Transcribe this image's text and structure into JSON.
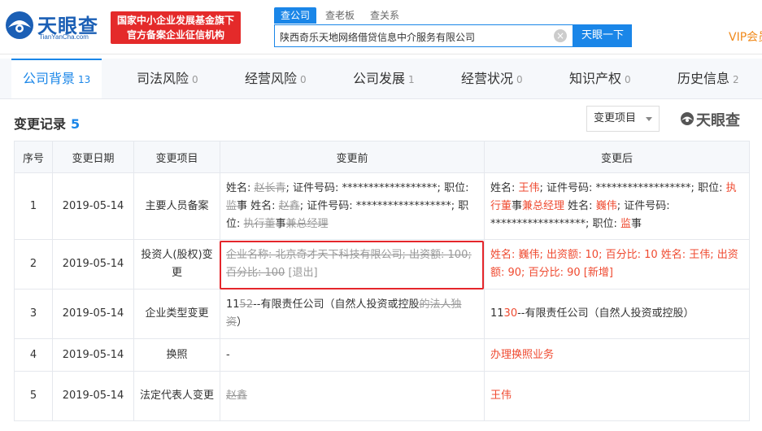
{
  "header": {
    "logo_name": "天眼查",
    "logo_domain": "TianYanCha.com",
    "badge_line1": "国家中小企业发展基金旗下",
    "badge_line2": "官方备案企业征信机构",
    "search_tabs": [
      "查公司",
      "查老板",
      "查关系"
    ],
    "search_value": "陕西奇乐天地网络借贷信息中介服务有限公司",
    "search_button": "天眼一下",
    "vip": "VIP会员"
  },
  "tabs": [
    {
      "label": "公司背景",
      "count": "13"
    },
    {
      "label": "司法风险",
      "count": "0"
    },
    {
      "label": "经营风险",
      "count": "0"
    },
    {
      "label": "公司发展",
      "count": "1"
    },
    {
      "label": "经营状况",
      "count": "0"
    },
    {
      "label": "知识产权",
      "count": "0"
    },
    {
      "label": "历史信息",
      "count": "2"
    }
  ],
  "section": {
    "title": "变更记录",
    "count": "5",
    "filter_label": "变更项目",
    "watermark": "天眼查"
  },
  "table": {
    "headers": [
      "序号",
      "变更日期",
      "变更项目",
      "变更前",
      "变更后"
    ],
    "rows": [
      {
        "no": "1",
        "date": "2019-05-14",
        "item": "主要人员备案",
        "before": [
          {
            "t": "姓名: "
          },
          {
            "t": "赵长青",
            "s": "strike"
          },
          {
            "t": "; 证件号码: ******************; 职位: "
          },
          {
            "t": "监",
            "s": "strike"
          },
          {
            "t": "事 姓名: "
          },
          {
            "t": "赵鑫",
            "s": "strike"
          },
          {
            "t": "; 证件号码: ******************; 职位: "
          },
          {
            "t": "执行董",
            "s": "strike"
          },
          {
            "t": "事"
          },
          {
            "t": "兼总经理",
            "s": "strike"
          }
        ],
        "after": [
          {
            "t": "姓名: "
          },
          {
            "t": "王伟",
            "s": "red"
          },
          {
            "t": "; 证件号码: ******************; 职位: "
          },
          {
            "t": "执行董",
            "s": "red"
          },
          {
            "t": "事"
          },
          {
            "t": "兼总经理",
            "s": "red"
          },
          {
            "t": " 姓名: "
          },
          {
            "t": "巍伟",
            "s": "red"
          },
          {
            "t": "; 证件号码: ******************; 职位: "
          },
          {
            "t": "监",
            "s": "red"
          },
          {
            "t": "事"
          }
        ]
      },
      {
        "no": "2",
        "date": "2019-05-14",
        "item": "投资人(股权)变更",
        "before": [
          {
            "t": "企业名称: 北京奇才天下科技有限公司; 出资额: 100; 百分比: 100",
            "s": "strike"
          },
          {
            "t": " [退出]",
            "s": "gray"
          }
        ],
        "after": [
          {
            "t": "姓名: 巍伟; 出资额: 10; 百分比: 10 姓名: 王伟; 出资额: 90; 百分比: 90 [新增]",
            "s": "red"
          }
        ]
      },
      {
        "no": "3",
        "date": "2019-05-14",
        "item": "企业类型变更",
        "before": [
          {
            "t": "11"
          },
          {
            "t": "52",
            "s": "strike"
          },
          {
            "t": "--有限责任公司（自然人投资或控股"
          },
          {
            "t": "的法人独资",
            "s": "strike"
          },
          {
            "t": "）"
          }
        ],
        "after": [
          {
            "t": "11"
          },
          {
            "t": "30",
            "s": "red"
          },
          {
            "t": "--有限责任公司（自然人投资或控股）"
          }
        ]
      },
      {
        "no": "4",
        "date": "2019-05-14",
        "item": "换照",
        "before": [
          {
            "t": "-"
          }
        ],
        "after": [
          {
            "t": "办理换照业务",
            "s": "red"
          }
        ]
      },
      {
        "no": "5",
        "date": "2019-05-14",
        "item": "法定代表人变更",
        "before": [
          {
            "t": "赵鑫",
            "s": "strike"
          }
        ],
        "after": [
          {
            "t": "王伟",
            "s": "red"
          }
        ]
      }
    ]
  },
  "colors": {
    "brand_blue": "#1a86e8",
    "highlight_red": "#e5262b",
    "added_red": "#ef4a30"
  }
}
